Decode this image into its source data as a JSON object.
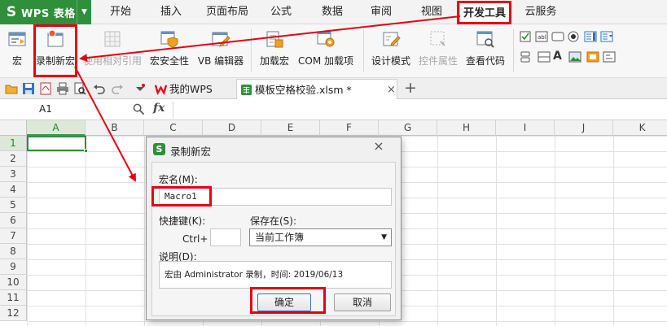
{
  "app": {
    "name": "WPS 表格"
  },
  "menu_tabs": [
    "开始",
    "插入",
    "页面布局",
    "公式",
    "数据",
    "审阅",
    "视图",
    "开发工具",
    "云服务"
  ],
  "ribbon": {
    "macro": "宏",
    "record_macro": "录制新宏",
    "relative_ref": "使用相对引用",
    "macro_security": "宏安全性",
    "vb_editor": "VB 编辑器",
    "load_macro": "加载宏",
    "com_addins": "COM 加载项",
    "design_mode": "设计模式",
    "control_props": "控件属性",
    "view_code": "查看代码"
  },
  "doc_tabs": {
    "home": "我的WPS",
    "file": "模板空格校验.xlsm *"
  },
  "formula_bar": {
    "cell_ref": "A1",
    "fx": "fx"
  },
  "grid": {
    "columns": [
      "A",
      "B",
      "C",
      "D",
      "E",
      "F",
      "G",
      "H",
      "I",
      "J",
      "K"
    ],
    "rows": [
      "1",
      "2",
      "3",
      "4",
      "5",
      "6",
      "7",
      "8",
      "9",
      "10",
      "11",
      "12"
    ],
    "selected_cell": "A1"
  },
  "dialog": {
    "title": "录制新宏",
    "macro_name_label": "宏名(M):",
    "macro_name_value": "Macro1",
    "shortcut_label": "快捷键(K):",
    "ctrl_label": "Ctrl+",
    "shortcut_value": "",
    "store_in_label": "保存在(S):",
    "store_in_value": "当前工作簿",
    "description_label": "说明(D):",
    "description_value": "宏由 Administrator 录制，时间: 2019/06/13",
    "ok_button": "确定",
    "cancel_button": "取消"
  },
  "colors": {
    "brand": "#2f8f3b",
    "highlight": "#e60012",
    "dev_tab_text": "#1a1a1a"
  }
}
